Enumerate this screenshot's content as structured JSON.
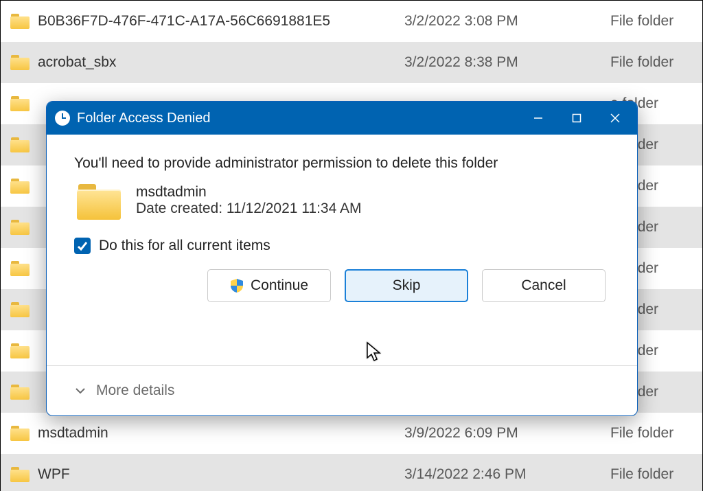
{
  "rows": [
    {
      "name": "B0B36F7D-476F-471C-A17A-56C6691881E5",
      "date": "3/2/2022 3:08 PM",
      "type": "File folder"
    },
    {
      "name": "acrobat_sbx",
      "date": "3/2/2022 8:38 PM",
      "type": "File folder"
    },
    {
      "name": "",
      "date": "",
      "type": "e folder"
    },
    {
      "name": "",
      "date": "",
      "type": "e folder"
    },
    {
      "name": "",
      "date": "",
      "type": "e folder"
    },
    {
      "name": "",
      "date": "",
      "type": "e folder"
    },
    {
      "name": "",
      "date": "",
      "type": "e folder"
    },
    {
      "name": "",
      "date": "",
      "type": "e folder"
    },
    {
      "name": "",
      "date": "",
      "type": "e folder"
    },
    {
      "name": "",
      "date": "",
      "type": "e folder"
    },
    {
      "name": "msdtadmin",
      "date": "3/9/2022 6:09 PM",
      "type": "File folder"
    },
    {
      "name": "WPF",
      "date": "3/14/2022 2:46 PM",
      "type": "File folder"
    }
  ],
  "dialog": {
    "title": "Folder Access Denied",
    "message": "You'll need to provide administrator permission to delete this folder",
    "item_name": "msdtadmin",
    "item_date_label": "Date created: 11/12/2021 11:34 AM",
    "checkbox_label": "Do this for all current items",
    "checkbox_checked": true,
    "continue_label": "Continue",
    "skip_label": "Skip",
    "cancel_label": "Cancel",
    "more_details_label": "More details"
  }
}
